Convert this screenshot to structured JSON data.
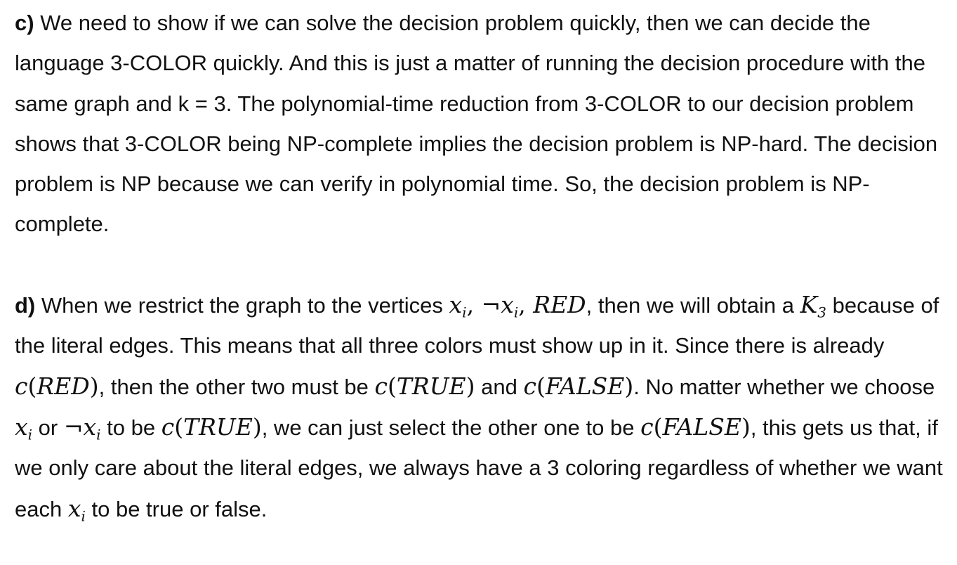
{
  "part_c": {
    "label": "c)",
    "text": " We need to show if we can solve the decision problem quickly, then we can decide the language 3-COLOR quickly. And this is just a matter of running the decision procedure with the same graph and k = 3. The polynomial-time reduction from 3-COLOR to our decision problem shows that 3-COLOR being NP-complete implies the decision problem is NP-hard. The decision problem is NP because we can verify in polynomial time. So, the decision problem is NP-complete."
  },
  "part_d": {
    "label": "d)",
    "t1": " When we restrict the graph to the vertices ",
    "math_red": "RED",
    "t2": ", then we will obtain a ",
    "math_k": "K",
    "math_k_sub": "3",
    "t3": " because of the literal edges. This means that all three colors must show up in it. Since there is already ",
    "c": "c",
    "red": "RED",
    "t4": ", then the other two must be ",
    "true": "TRUE",
    "t5": " and ",
    "false": "FALSE",
    "t6": ". No matter whether we choose ",
    "x": "x",
    "i": "i",
    "neg": "¬",
    "t7": " or ",
    "t8": " to be ",
    "t9": ", we can just select the other one to be ",
    "t10": ", this gets us that, if we only care about the literal edges, we always have a 3 coloring regardless of whether we want each ",
    "t11": " to be true or false."
  }
}
